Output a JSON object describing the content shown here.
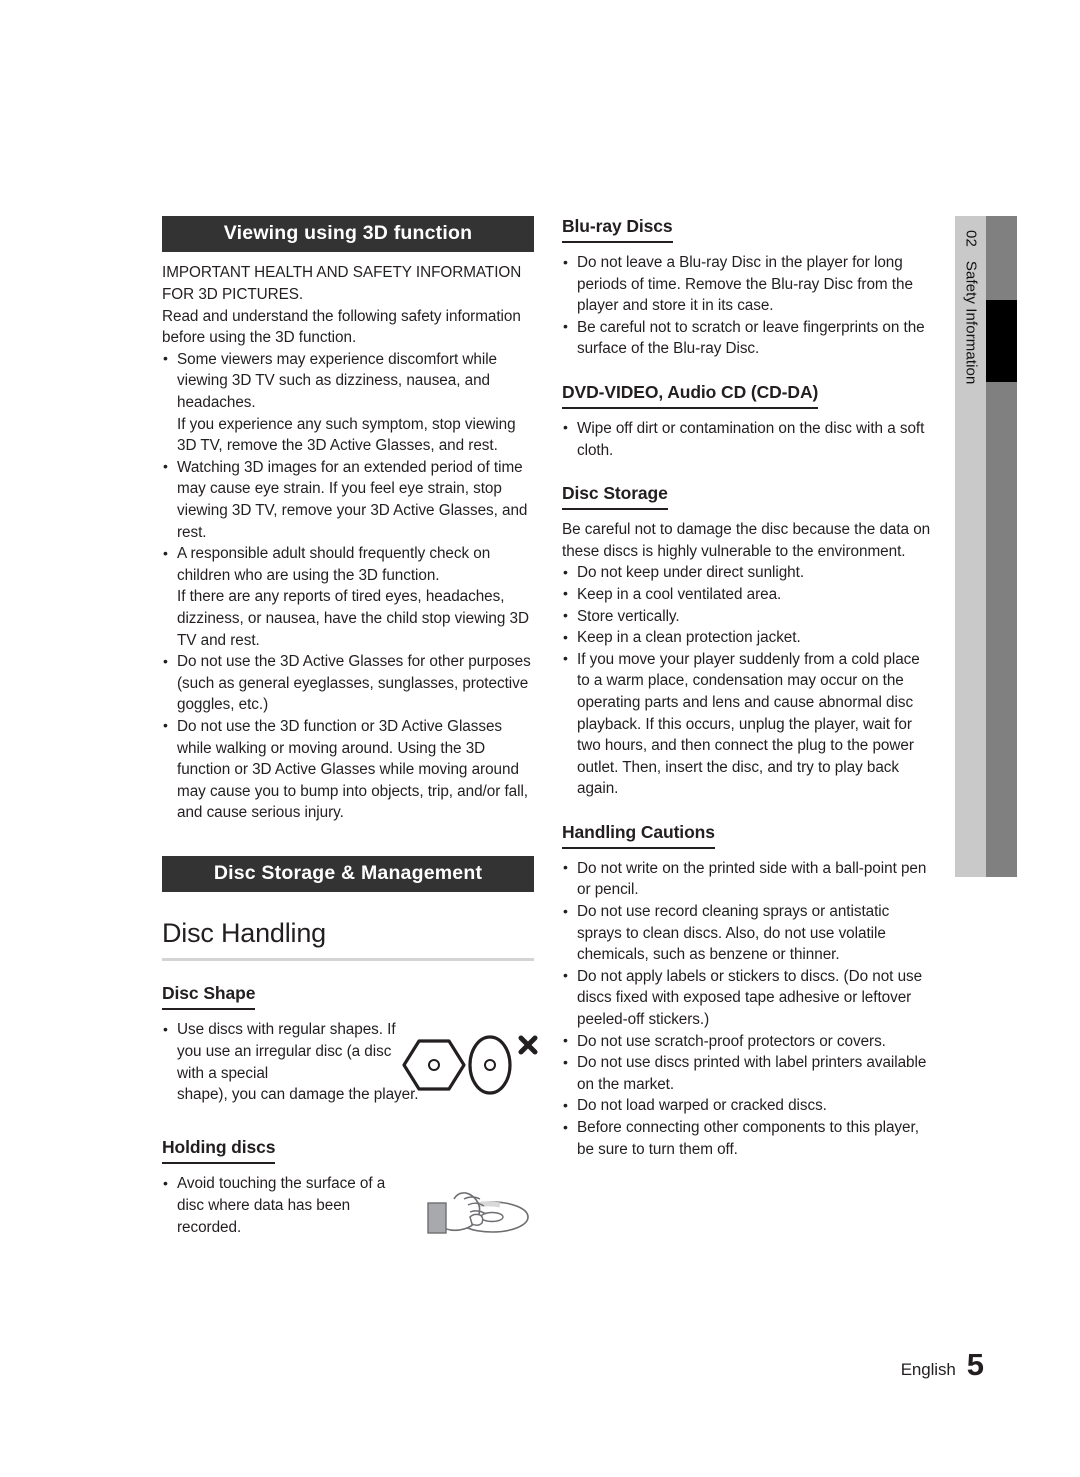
{
  "document": {
    "language_label": "English",
    "page_number": "5"
  },
  "side_tab": {
    "chapter_number": "02",
    "chapter_title": "Safety Information"
  },
  "left_column": {
    "banner_3d": "Viewing using 3D function",
    "intro": [
      "IMPORTANT HEALTH AND SAFETY INFORMATION FOR 3D PICTURES.",
      "Read and understand the following safety information before using the 3D function."
    ],
    "bullets_3d": [
      {
        "main": "Some viewers may experience discomfort while viewing 3D TV such as dizziness, nausea, and headaches.",
        "cont": "If you experience any such symptom, stop viewing 3D TV, remove the 3D Active Glasses, and rest."
      },
      {
        "main": "Watching 3D images for an extended period of time may cause eye strain. If you feel eye strain, stop viewing 3D TV, remove your 3D Active Glasses, and rest.",
        "cont": ""
      },
      {
        "main": "A responsible adult should frequently check on children who are using the 3D function.",
        "cont": "If there are any reports of tired eyes, headaches, dizziness, or nausea, have the child stop viewing 3D TV and rest."
      },
      {
        "main": "Do not use the 3D Active Glasses for other purposes (such as general eyeglasses, sunglasses, protective goggles, etc.)",
        "cont": ""
      },
      {
        "main": "Do not use the 3D function or 3D Active Glasses while walking or moving around. Using the 3D function or 3D Active Glasses while moving around may cause you to bump into objects, trip, and/or fall, and cause serious injury.",
        "cont": ""
      }
    ],
    "banner_storage": "Disc Storage & Management",
    "disc_handling_title": "Disc Handling",
    "disc_shape": {
      "heading": "Disc Shape",
      "bullet_part1": "Use discs with regular shapes. If you use an irregular disc (a disc with a special",
      "bullet_part2": "shape), you can damage the player."
    },
    "holding_discs": {
      "heading": "Holding discs",
      "bullet": "Avoid touching the surface of a disc where data has been recorded."
    }
  },
  "right_column": {
    "bluray": {
      "heading": "Blu-ray Discs",
      "bullets": [
        "Do not leave a Blu-ray Disc in the player for long periods of time. Remove the Blu-ray Disc from the player and store it in its case.",
        "Be careful not to scratch or leave fingerprints on the surface of the Blu-ray Disc."
      ]
    },
    "dvd": {
      "heading": "DVD-VIDEO, Audio CD (CD-DA)",
      "bullets": [
        "Wipe off dirt or contamination on the disc with a soft cloth."
      ]
    },
    "disc_storage": {
      "heading": "Disc Storage",
      "intro": "Be careful not to damage the disc because the data on these discs is highly vulnerable to the environment.",
      "bullets": [
        "Do not keep under direct sunlight.",
        "Keep in a cool ventilated area.",
        "Store vertically.",
        "Keep in a clean protection jacket.",
        "If you move your player suddenly from a cold place to a warm place, condensation may occur on the operating parts and lens and cause abnormal disc playback. If this occurs, unplug the player, wait for two hours, and then connect the plug to the power outlet. Then, insert the disc, and try to play back again."
      ]
    },
    "handling_cautions": {
      "heading": "Handling Cautions",
      "bullets": [
        "Do not write on the printed side with a ball-point pen or pencil.",
        "Do not use record cleaning sprays or antistatic sprays to clean discs. Also, do not use volatile chemicals, such as benzene or thinner.",
        "Do not apply labels or stickers to discs. (Do not use discs fixed with exposed tape adhesive or leftover peeled-off stickers.)",
        "Do not use scratch-proof protectors or covers.",
        "Do not use discs printed with label printers available on the market.",
        "Do not load warped or cracked discs.",
        "Before connecting other components to this player, be sure to turn them off."
      ]
    }
  },
  "colors": {
    "banner_bg": "#333333",
    "tab_light": "#c9c9c9",
    "tab_dark": "#808080",
    "tab_marker": "#000000",
    "rule_light": "#d4d4d4",
    "text": "#231f20"
  }
}
